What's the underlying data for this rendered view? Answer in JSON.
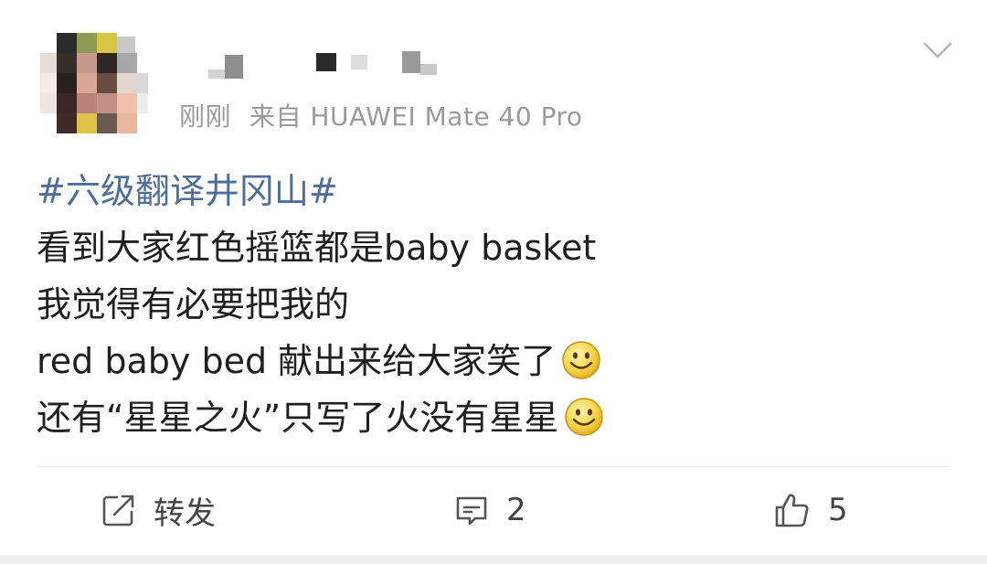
{
  "post": {
    "meta": {
      "time": "刚刚",
      "source": "来自 HUAWEI Mate 40 Pro"
    },
    "hashtag": "#六级翻译井冈山#",
    "lines": [
      "看到大家红色摇篮都是baby basket",
      "我觉得有必要把我的",
      "red baby bed 献出来给大家笑了",
      "还有“星星之火”只写了火没有星星"
    ],
    "emoji": "smile-emoji",
    "actions": {
      "repost_label": "转发",
      "comment_count": "2",
      "like_count": "5"
    }
  },
  "colors": {
    "hashtag": "#4e6e9a",
    "meta": "#9a9a9a",
    "text": "#1f1f1f"
  }
}
